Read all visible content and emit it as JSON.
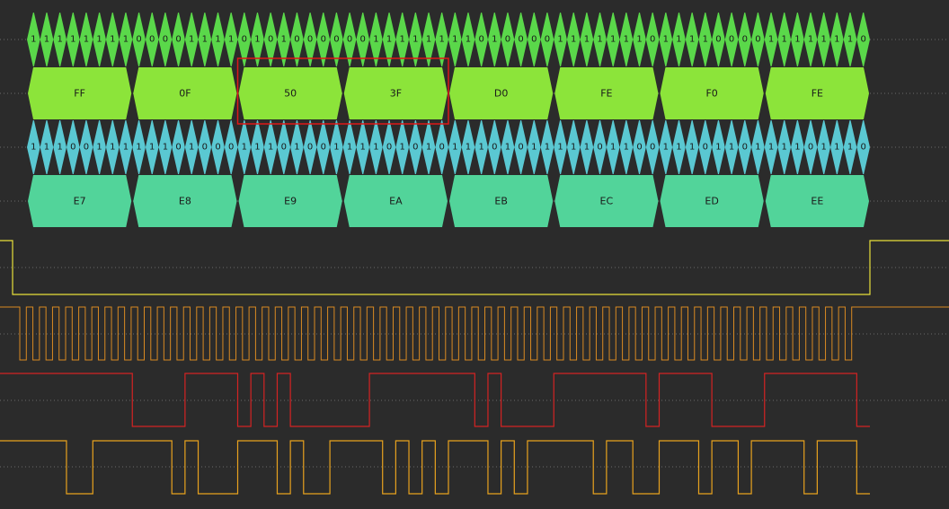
{
  "decoder": {
    "mosi": {
      "bits": "1111111100001111010100000011111111010000111111101111000011111110",
      "bytes": [
        "FF",
        "0F",
        "50",
        "3F",
        "D0",
        "FE",
        "F0",
        "FE"
      ],
      "bit_color": "#5ad84a",
      "byte_color": "#8ce43a",
      "highlight": {
        "from_byte": 2,
        "to_byte": 3,
        "color": "#e01818"
      }
    },
    "miso": {
      "bits": "1110011111101000111010011110101011101011111011001110110111101110",
      "bytes": [
        "E7",
        "E8",
        "E9",
        "EA",
        "EB",
        "EC",
        "ED",
        "EE"
      ],
      "bit_color": "#5ac8d2",
      "byte_color": "#52d49a"
    }
  },
  "signals": {
    "cs_enable": {
      "color": "#e8e03a",
      "levels": [
        1,
        0,
        1
      ]
    },
    "clock": {
      "color": "#d98a22",
      "cycles": 64
    },
    "mosi_line": {
      "color": "#d42323",
      "source": "mosi"
    },
    "miso_line": {
      "color": "#e8a21e",
      "source": "miso"
    }
  },
  "colors": {
    "background": "#2b2b2b",
    "grid_dots": "#6a6a6a",
    "text": "#1a1a1a"
  }
}
